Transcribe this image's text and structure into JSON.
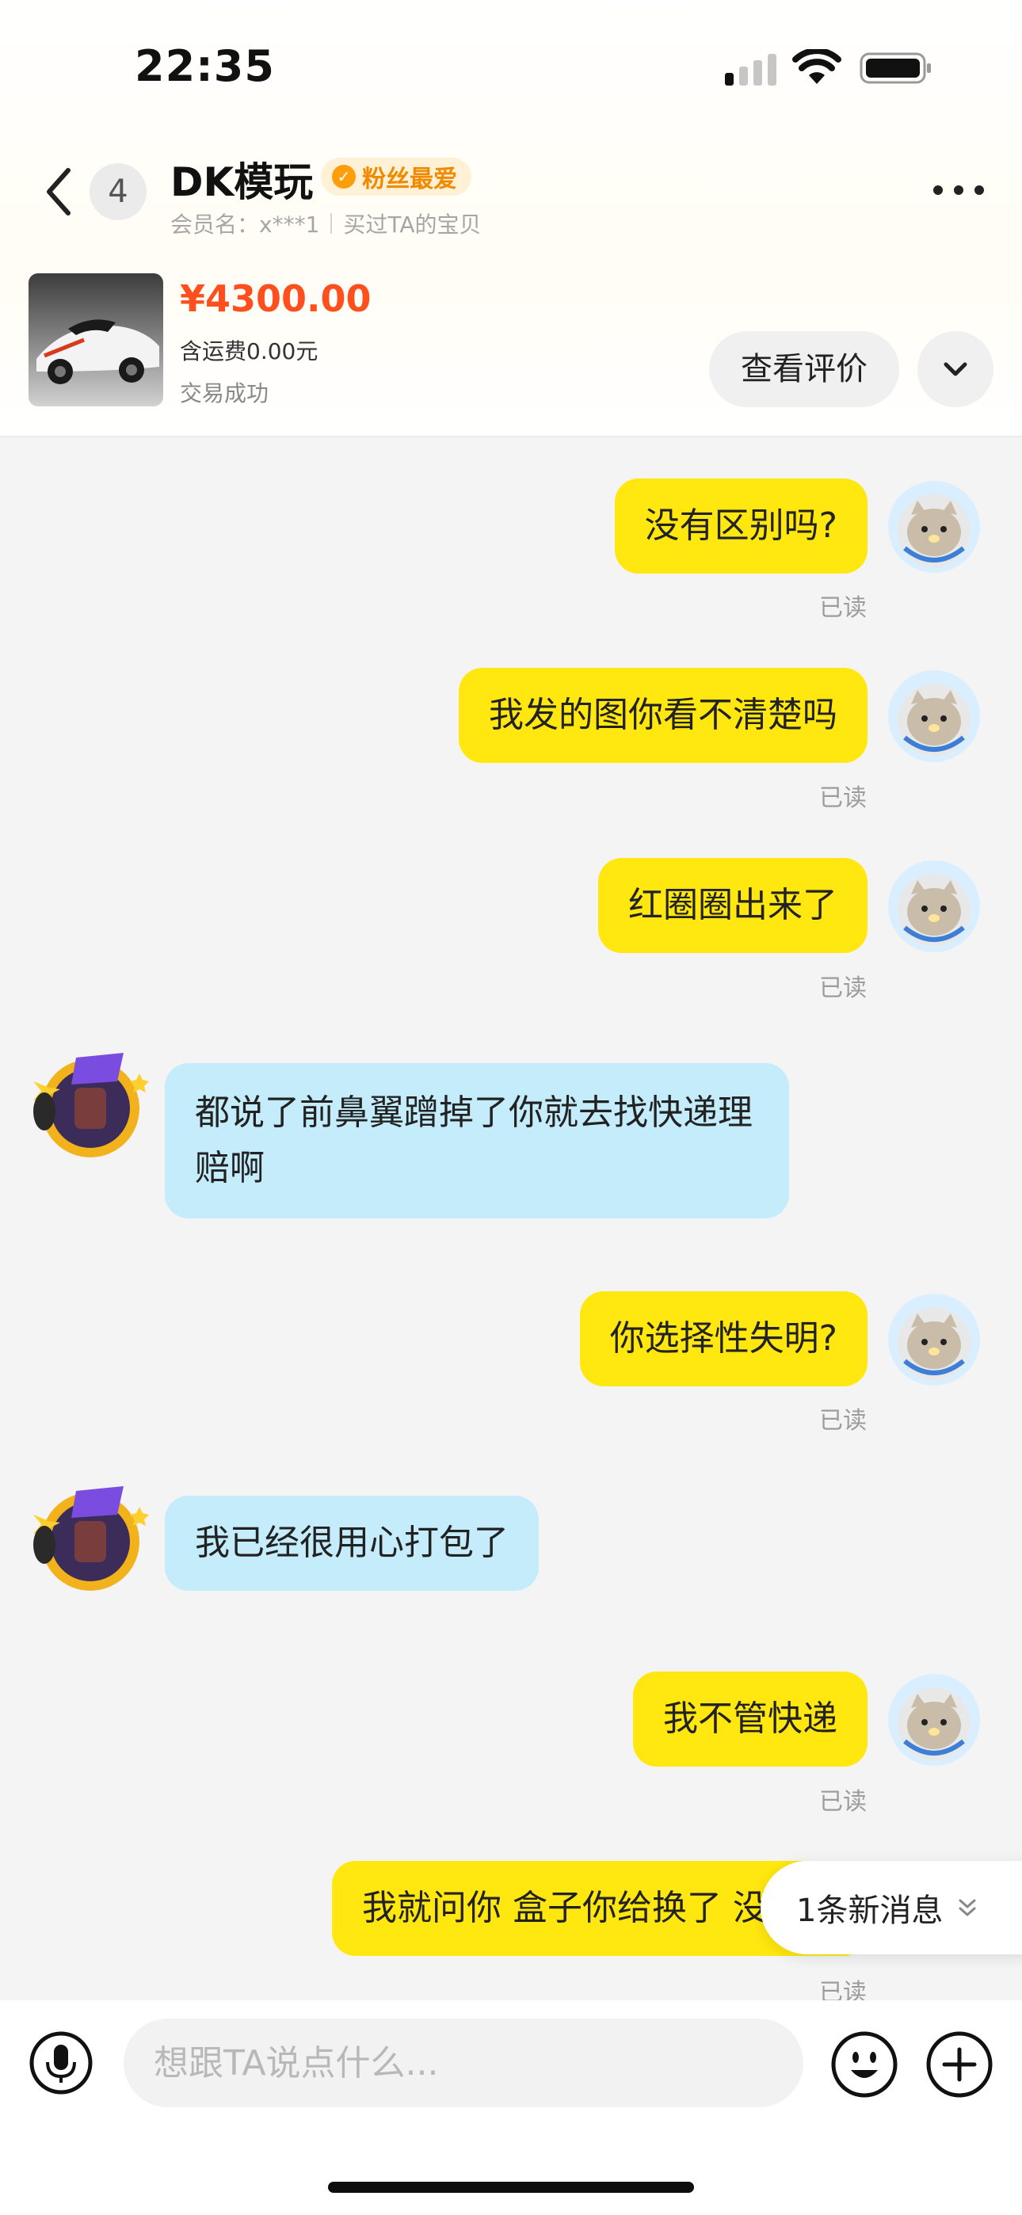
{
  "status_bar": {
    "time": "22:35"
  },
  "header": {
    "unread_count": "4",
    "shop_name": "DK模玩",
    "fan_badge": "粉丝最爱",
    "member_label": "会员名：x***1",
    "purchase_note": "买过TA的宝贝"
  },
  "order": {
    "price": "¥4300.00",
    "shipping": "含运费0.00元",
    "status": "交易成功",
    "review_label": "查看评价"
  },
  "messages": [
    {
      "from": "me",
      "text": "没有区别吗?",
      "read": "已读"
    },
    {
      "from": "me",
      "text": "我发的图你看不清楚吗",
      "read": "已读"
    },
    {
      "from": "me",
      "text": "红圈圈出来了",
      "read": "已读"
    },
    {
      "from": "them",
      "lines": [
        "都说了前鼻翼蹭掉了你就去找快递理",
        "赔啊"
      ]
    },
    {
      "from": "me",
      "text": "你选择性失明?",
      "read": "已读"
    },
    {
      "from": "them",
      "lines": [
        "我已经很用心打包了"
      ]
    },
    {
      "from": "me",
      "text": "我不管快递",
      "read": "已读"
    },
    {
      "from": "me",
      "text": "我就问你 盒子你给换了 没告诉",
      "read": "已读"
    }
  ],
  "new_message_pill": "1条新消息",
  "input": {
    "placeholder": "想跟TA说点什么..."
  },
  "colors": {
    "my_bubble": "#ffe70f",
    "their_bubble": "#c4ecfb",
    "price": "#ff4f1f",
    "badge_text": "#f08a00"
  },
  "icons": [
    "back-arrow-icon",
    "more-icon",
    "chevron-down-icon",
    "microphone-icon",
    "emoji-icon",
    "plus-icon",
    "double-chevron-down-icon"
  ]
}
